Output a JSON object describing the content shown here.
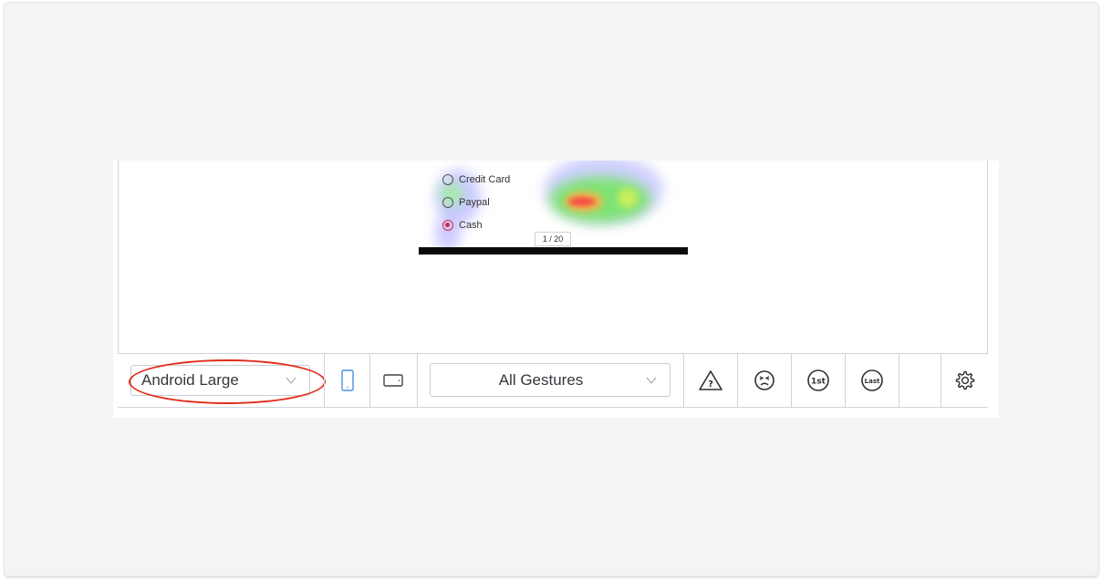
{
  "preview": {
    "options": [
      {
        "label": "Credit Card",
        "checked": false
      },
      {
        "label": "Paypal",
        "checked": false
      },
      {
        "label": "Cash",
        "checked": true
      }
    ],
    "pager": "1 / 20"
  },
  "toolbar": {
    "device_select": {
      "value": "Android Large"
    },
    "gesture_select": {
      "value": "All Gestures"
    },
    "icons": [
      "phone-portrait-icon",
      "tablet-landscape-icon",
      "warning-question-icon",
      "frustrated-face-icon",
      "first-badge-icon",
      "last-badge-icon",
      "gear-icon"
    ],
    "first_badge": "1st",
    "last_badge": "Last",
    "warning_glyph": "?"
  },
  "colors": {
    "accent_blue": "#4a90e2",
    "highlight_red": "#e32c19",
    "radio_checked": "#d8264b",
    "border": "#cfd3d8"
  }
}
